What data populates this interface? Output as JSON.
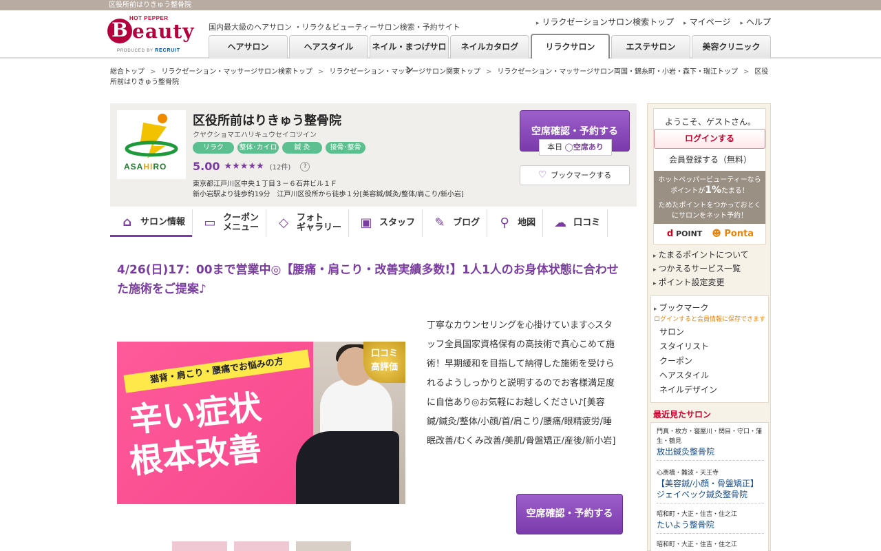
{
  "topstrip": {
    "title": "区役所前はりきゅう整骨院"
  },
  "header": {
    "logo": {
      "hotpepper": "HOT PEPPER",
      "b": "B",
      "eauty": "eauty",
      "produced": "PRODUCED BY",
      "recruit": "RECRUIT"
    },
    "tagline": "国内最大級のヘアサロン ・リラク＆ビューティーサロン検索・予約サイト",
    "links": [
      "リラクゼーションサロン検索トップ",
      "マイページ",
      "ヘルプ"
    ],
    "tabs": [
      "ヘアサロン",
      "ヘアスタイル",
      "ネイル・まつげサロン",
      "ネイルカタログ",
      "リラクサロン",
      "エステサロン",
      "美容クリニック"
    ]
  },
  "breadcrumb": {
    "items": [
      "総合トップ",
      "リラクゼーション・マッサージサロン検索トップ",
      "リラクゼーション・マッサージサロン関東トップ",
      "リラクゼーション・マッサージサロン両国・錦糸町・小岩・森下・瑞江トップ",
      "区役所前はりきゅう整骨院"
    ]
  },
  "salon": {
    "logo_text_a": "ASA",
    "logo_text_b": "HI",
    "logo_text_c": "RO",
    "name": "区役所前はりきゅう整骨院",
    "kana": "クヤクショマエハリキュウセイコツイン",
    "tags": [
      "リラク",
      "整体･カイロ",
      "鍼 灸",
      "接骨･整骨"
    ],
    "score": "5.00",
    "stars": "★★★★★",
    "review_count": "(12件)",
    "help": "?",
    "address": "東京都江戸川区中央１丁目３－６石井ビル１Ｆ",
    "access": "新小岩駅より徒歩約19分　江戸川区役所から徒歩１分[美容鍼/鍼灸/整体/肩こり/新小岩]",
    "reserve_label": "空席確認・予約する",
    "today_label": "本日",
    "today_status": "◯空席あり",
    "bookmark_label": "ブックマークする"
  },
  "subnav": [
    {
      "icon": "home-icon",
      "glyph": "⌂",
      "label": "サロン情報"
    },
    {
      "icon": "coupon-icon",
      "glyph": "▭",
      "label": "クーポン\nメニュー"
    },
    {
      "icon": "photo-icon",
      "glyph": "◇",
      "label": "フォト\nギャラリー"
    },
    {
      "icon": "staff-icon",
      "glyph": "▣",
      "label": "スタッフ"
    },
    {
      "icon": "pen-icon",
      "glyph": "✎",
      "label": "ブログ"
    },
    {
      "icon": "pin-icon",
      "glyph": "⚲",
      "label": "地図"
    },
    {
      "icon": "chat-icon",
      "glyph": "☁",
      "label": "口コミ"
    }
  ],
  "catch": "4/26(日)17：00まで営業中◎【腰痛・肩こり・改善実績多数!】1人1人のお身体状態に合わせた施術をご提案♪",
  "image": {
    "ribbon": "猫背・肩こり・腰痛でお悩みの方",
    "big1": "辛い症状",
    "big2": "根本改善",
    "badge": "口コミ\n高評価"
  },
  "description": "丁寧なカウンセリングを心掛けています◇スタッフ全員国家資格保有の高技術で真心こめて施術！早期緩和を目指して納得した施術を受けられるようしっかりと説明するのでお客様満足度に自信あり◎お気軽にお越しください♪[美容鍼/鍼灸/整体/小顔/首/肩こり/腰痛/眼精疲労/睡眠改善/むくみ改善/美肌/骨盤矯正/産後/新小岩]",
  "reserve2_label": "空席確認・予約する",
  "sidebar": {
    "welcome": "ようこそ、ゲストさん。",
    "login": "ログインする",
    "register": "会員登録する（無料）",
    "point_line1": "ホットペッパービューティーなら",
    "point_line2a": "ポイントが",
    "point_big": "1%",
    "point_line2b": "たまる！",
    "point_line3": "ためたポイントをつかっておとく",
    "point_line4": "にサロンをネット予約！",
    "dpoint_d": "d",
    "dpoint": "POINT",
    "ponta": "Ponta",
    "links": [
      "たまるポイントについて",
      "つかえるサービス一覧",
      "ポイント設定変更"
    ],
    "bookmark_title": "ブックマーク",
    "bookmark_note": "ログインすると会員情報に保存できます",
    "bookmark_items": [
      "サロン",
      "スタイリスト",
      "クーポン",
      "ヘアスタイル",
      "ネイルデザイン"
    ],
    "recent_title": "最近見たサロン",
    "recent": [
      {
        "area": "門真・枚方・寝屋川・関目・守口・蒲生・鶴見",
        "name": "放出鍼灸整骨院"
      },
      {
        "area": "心斎橋・難波・天王寺",
        "name": "【美容鍼/小顔・骨盤矯正】ジェイペック鍼灸整骨院"
      },
      {
        "area": "昭和町・大正・住吉・住之江",
        "name": "たいよう整骨院"
      },
      {
        "area": "昭和町・大正・住吉・住之江",
        "name": ""
      }
    ]
  }
}
